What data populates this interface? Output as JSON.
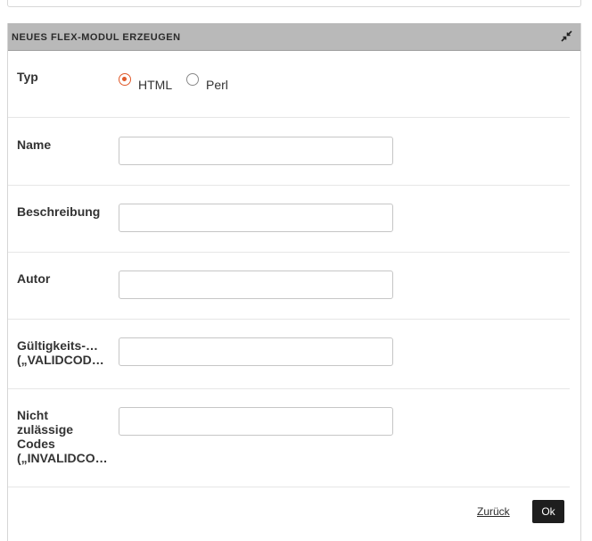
{
  "dialog": {
    "title": "NEUES FLEX-MODUL ERZEUGEN",
    "collapse_icon": "collapse-arrows-icon"
  },
  "form": {
    "type_label": "Typ",
    "type_options": [
      {
        "label": "HTML",
        "checked": true
      },
      {
        "label": "Perl",
        "checked": false
      }
    ],
    "name_label": "Name",
    "name_value": "",
    "description_label": "Beschreibung",
    "description_value": "",
    "author_label": "Autor",
    "author_value": "",
    "valid_codes_label_line1": "Gültigkeits-…",
    "valid_codes_label_line2": "(„VALIDCOD…",
    "valid_codes_value": "",
    "invalid_codes_label_line1": "Nicht",
    "invalid_codes_label_line2": "zulässige",
    "invalid_codes_label_line3": "Codes",
    "invalid_codes_label_line4": "(„INVALIDCO…",
    "invalid_codes_value": ""
  },
  "footer": {
    "back_label": "Zurück",
    "ok_label": "Ok"
  },
  "colors": {
    "header_bg": "#b9b9b9",
    "radio_accent": "#e05a2b",
    "ok_bg": "#1e1e1e"
  }
}
